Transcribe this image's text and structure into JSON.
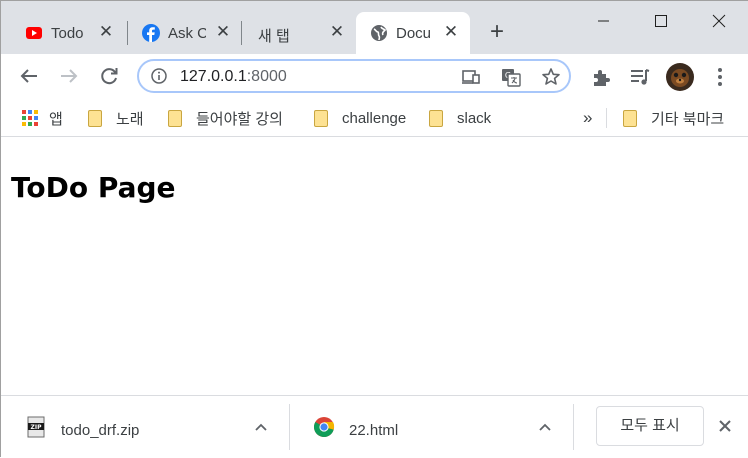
{
  "window": {
    "minimize_glyph": "—",
    "maximize_glyph": "☐",
    "close_glyph": "✕"
  },
  "tabs": [
    {
      "title": "Todo",
      "icon": "youtube-icon",
      "active": false
    },
    {
      "title": "Ask C",
      "icon": "facebook-icon",
      "active": false
    },
    {
      "title": "새 탭",
      "icon": "none",
      "active": false
    },
    {
      "title": "Docu",
      "icon": "globe-icon",
      "active": true
    }
  ],
  "new_tab_glyph": "+",
  "tab_close_glyph": "✕",
  "address": {
    "host": "127.0.0.1",
    "port": ":8000"
  },
  "bookmarks": {
    "apps_label": "앱",
    "items": [
      {
        "label": "노래"
      },
      {
        "label": "들어야할 강의"
      },
      {
        "label": "challenge"
      },
      {
        "label": "slack"
      }
    ],
    "overflow_glyph": "»",
    "other_label": "기타 북마크"
  },
  "page": {
    "heading": "ToDo Page"
  },
  "downloads": {
    "items": [
      {
        "name": "todo_drf.zip",
        "icon": "zip-file-icon"
      },
      {
        "name": "22.html",
        "icon": "chrome-icon"
      }
    ],
    "show_all_label": "모두 표시"
  },
  "colors": {
    "tabstrip": "#dee1e6",
    "omnibox_border": "#a8c7fa",
    "youtube": "#ff0000",
    "facebook": "#1877f2",
    "folder": "#fde293"
  }
}
